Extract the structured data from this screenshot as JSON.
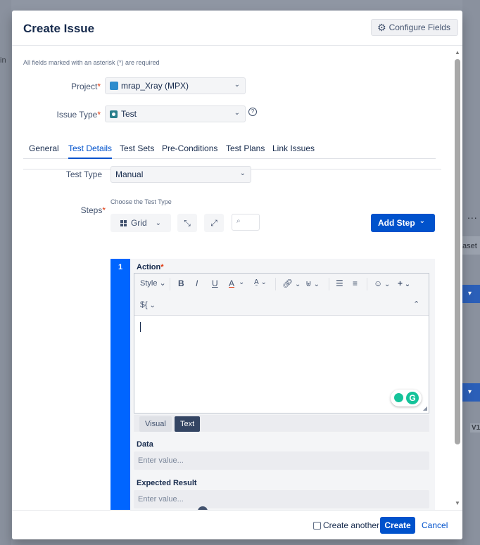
{
  "background": {
    "left_text": "in",
    "right_set": "aset",
    "right_version": "V1",
    "dots": "..."
  },
  "modal": {
    "title": "Create Issue",
    "configure_fields": "Configure Fields",
    "required_note": "All fields marked with an asterisk (*) are required"
  },
  "form": {
    "project_label": "Project",
    "project_value": "mrap_Xray (MPX)",
    "issue_type_label": "Issue Type",
    "issue_type_value": "Test",
    "asterisk": "*",
    "help": "?"
  },
  "tabs": [
    "General",
    "Test Details",
    "Test Sets",
    "Pre-Conditions",
    "Test Plans",
    "Link Issues"
  ],
  "test_details": {
    "test_type_label": "Test Type",
    "test_type_value": "Manual",
    "test_type_note": "Choose the Test Type",
    "steps_label": "Steps",
    "grid_label": "Grid",
    "add_step": "Add Step"
  },
  "step": {
    "number": "1",
    "action_label": "Action",
    "toolbar": {
      "style": "Style",
      "bold": "B",
      "italic": "I",
      "underline": "U",
      "color": "A",
      "vars": "${"
    },
    "mode_visual": "Visual",
    "mode_text": "Text",
    "data_label": "Data",
    "data_placeholder": "Enter value...",
    "expected_label": "Expected Result",
    "expected_placeholder": "Enter value..."
  },
  "footer": {
    "create_another": "Create another",
    "create": "Create",
    "cancel": "Cancel"
  }
}
